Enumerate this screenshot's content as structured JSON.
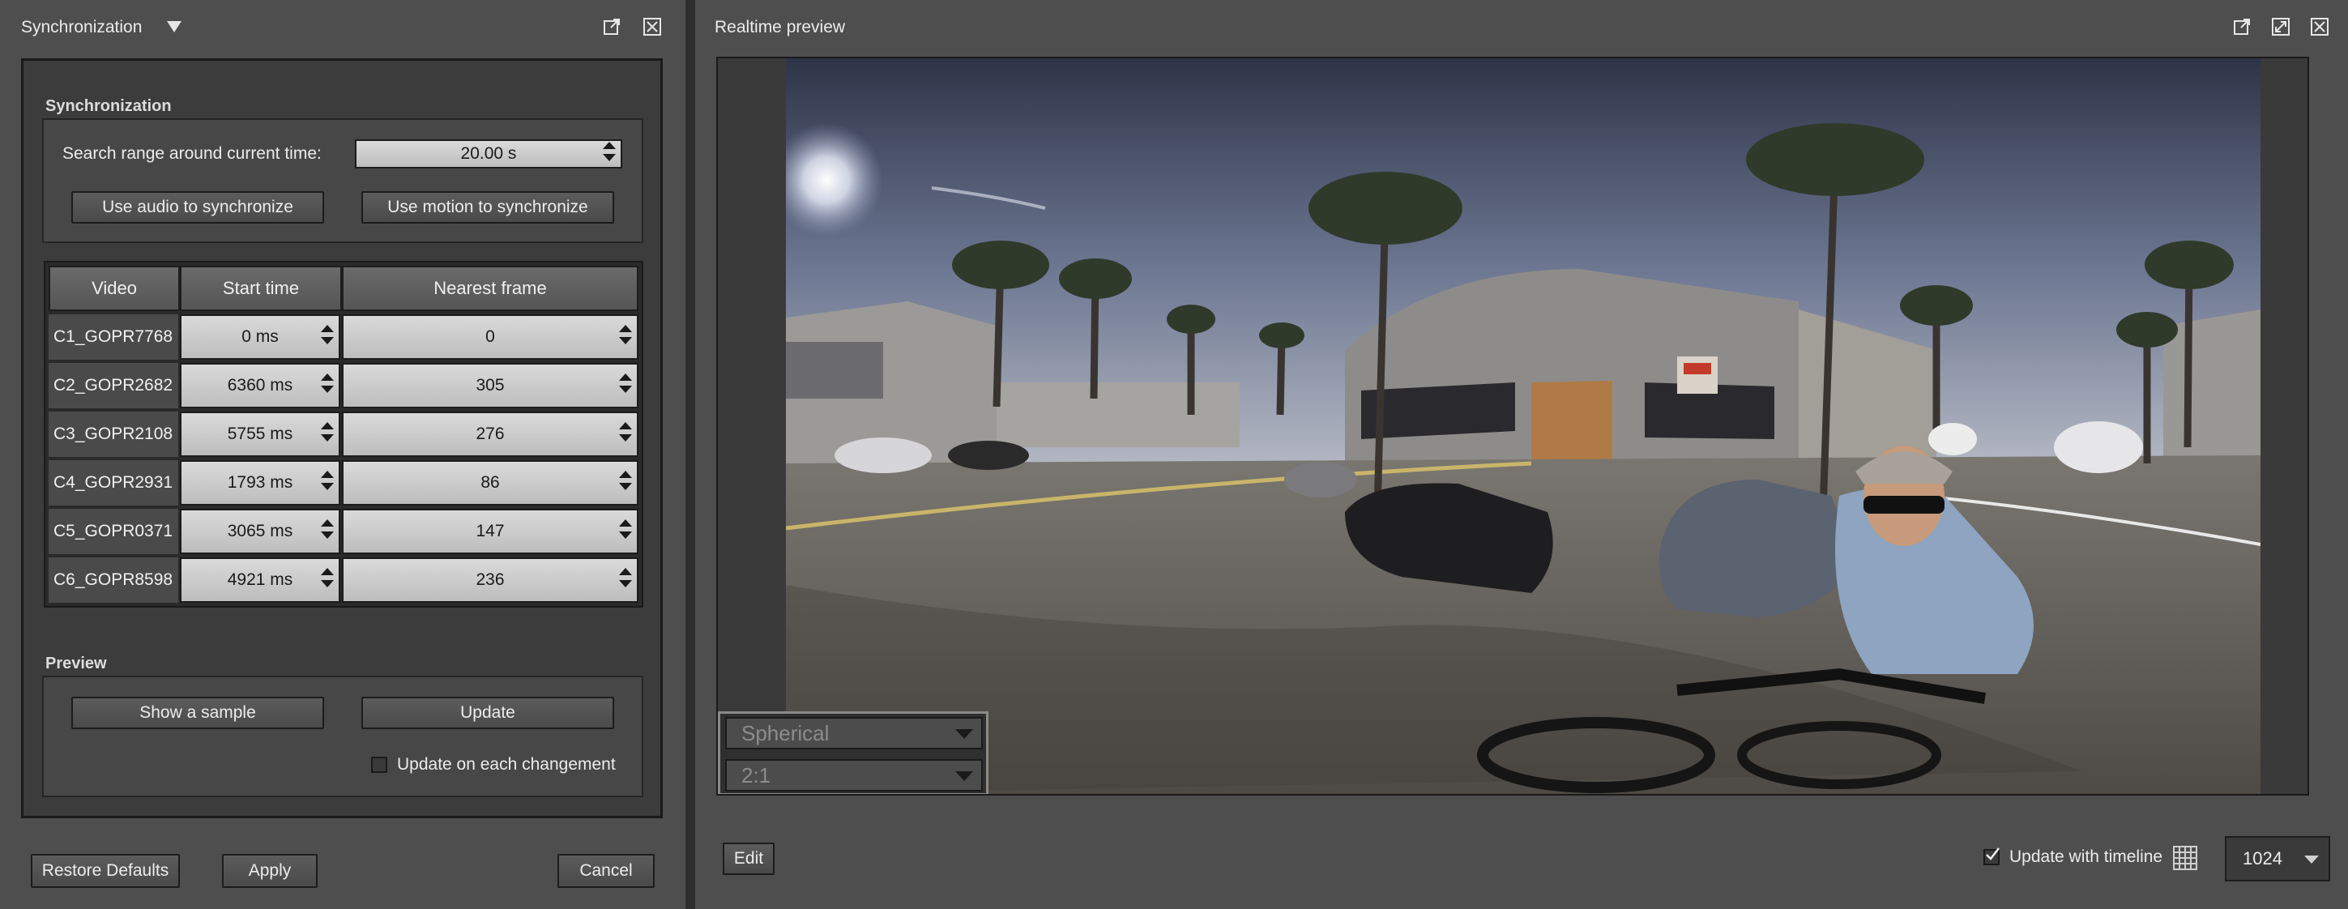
{
  "left_panel": {
    "title": "Synchronization",
    "icons": [
      "dropdown-arrow-icon",
      "popout-icon",
      "close-icon"
    ],
    "sync_section": {
      "label": "Synchronization",
      "search_range_label": "Search range around current time:",
      "search_range_value": "20.00 s",
      "audio_button": "Use audio to synchronize",
      "motion_button": "Use motion to synchronize"
    },
    "table": {
      "headers": [
        "Video",
        "Start time",
        "Nearest frame"
      ],
      "rows": [
        {
          "video": "C1_GOPR7768",
          "start": "0 ms",
          "frame": "0"
        },
        {
          "video": "C2_GOPR2682",
          "start": "6360 ms",
          "frame": "305"
        },
        {
          "video": "C3_GOPR2108",
          "start": "5755 ms",
          "frame": "276"
        },
        {
          "video": "C4_GOPR2931",
          "start": "1793 ms",
          "frame": "86"
        },
        {
          "video": "C5_GOPR0371",
          "start": "3065 ms",
          "frame": "147"
        },
        {
          "video": "C6_GOPR8598",
          "start": "4921 ms",
          "frame": "236"
        }
      ]
    },
    "preview_section": {
      "label": "Preview",
      "sample_button": "Show a sample",
      "update_button": "Update",
      "update_each_label": "Update on each changement",
      "update_each_checked": false
    },
    "footer": {
      "restore_button": "Restore Defaults",
      "apply_button": "Apply",
      "cancel_button": "Cancel"
    }
  },
  "right_panel": {
    "title": "Realtime preview",
    "icons": [
      "popout-icon",
      "fullscreen-icon",
      "close-icon"
    ],
    "projection": "Spherical",
    "aspect": "2:1",
    "edit_button": "Edit",
    "update_timeline_label": "Update with timeline",
    "update_timeline_checked": true,
    "resolution": "1024"
  }
}
